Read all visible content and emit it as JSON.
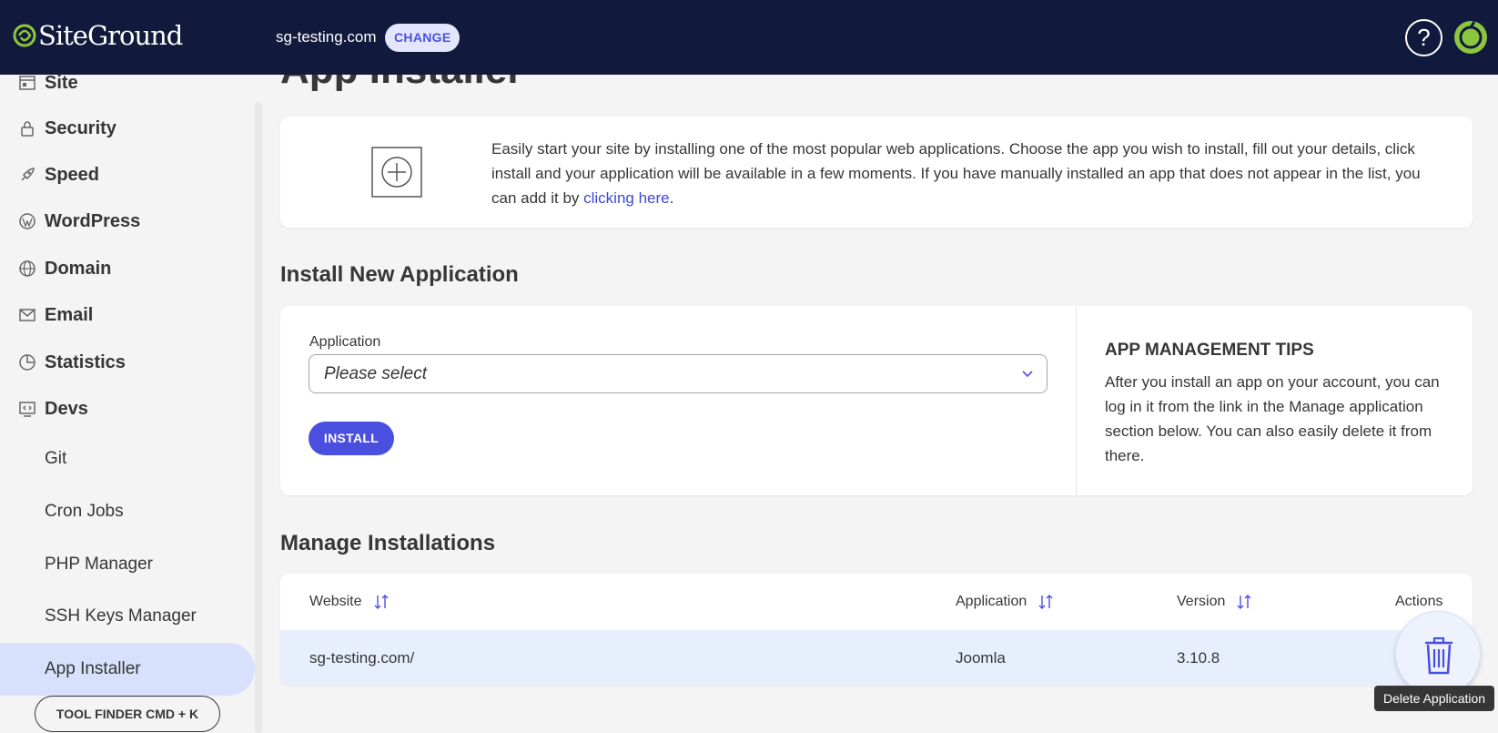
{
  "header": {
    "logo_text": "SiteGround",
    "site_name": "sg-testing.com",
    "change_label": "CHANGE",
    "help_label": "?"
  },
  "sidebar": {
    "items": [
      {
        "label": "Site",
        "icon": "site-icon"
      },
      {
        "label": "Security",
        "icon": "lock-icon"
      },
      {
        "label": "Speed",
        "icon": "rocket-icon"
      },
      {
        "label": "WordPress",
        "icon": "wordpress-icon"
      },
      {
        "label": "Domain",
        "icon": "globe-icon"
      },
      {
        "label": "Email",
        "icon": "envelope-icon"
      },
      {
        "label": "Statistics",
        "icon": "pie-chart-icon"
      },
      {
        "label": "Devs",
        "icon": "code-icon"
      }
    ],
    "sub_items": [
      {
        "label": "Git"
      },
      {
        "label": "Cron Jobs"
      },
      {
        "label": "PHP Manager"
      },
      {
        "label": "SSH Keys Manager"
      },
      {
        "label": "App Installer",
        "active": true
      }
    ],
    "tool_finder": "TOOL FINDER CMD + K"
  },
  "main": {
    "page_title": "App Installer",
    "intro": {
      "text": "Easily start your site by installing one of the most popular web applications. Choose the app you wish to install, fill out your details, click install and your application will be available in a few moments. If you have manually installed an app that does not appear in the list, you can add it by ",
      "link": "clicking here",
      "end": "."
    },
    "install": {
      "section_title": "Install New Application",
      "field_label": "Application",
      "select_value": "Please select",
      "install_label": "INSTALL",
      "tips_title": "APP MANAGEMENT TIPS",
      "tips_text": "After you install an app on your account, you can log in it from the link in the Manage application section below. You can also easily delete it from there."
    },
    "manage": {
      "section_title": "Manage Installations",
      "columns": [
        "Website",
        "Application",
        "Version",
        "Actions"
      ],
      "rows": [
        {
          "website": "sg-testing.com/",
          "application": "Joomla",
          "version": "3.10.8"
        }
      ]
    },
    "tooltip": "Delete Application"
  },
  "colors": {
    "header_bg": "#111a3c",
    "accent": "#4a4fe0",
    "active_nav": "#d7e1fb",
    "row_highlight": "#e8effc"
  }
}
